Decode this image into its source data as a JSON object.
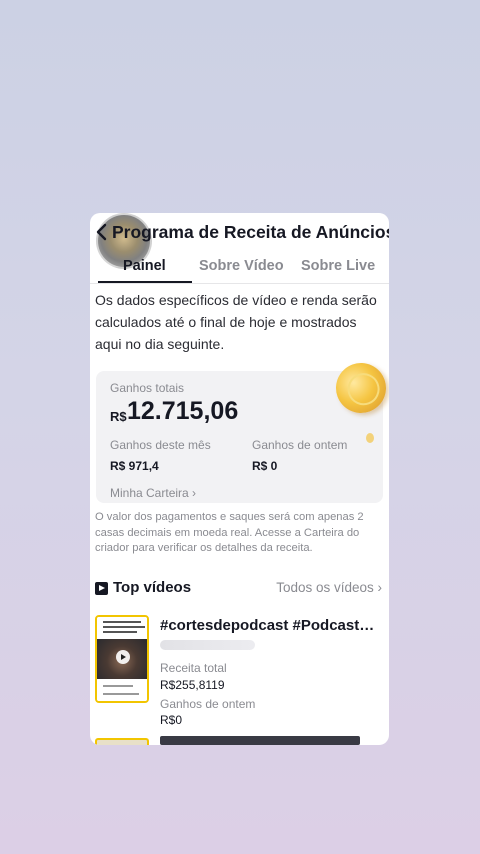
{
  "header": {
    "title": "Programa de Receita de Anúncios"
  },
  "tabs": [
    {
      "label": "Painel",
      "active": true
    },
    {
      "label": "Sobre Vídeo",
      "active": false
    },
    {
      "label": "Sobre Live",
      "active": false
    }
  ],
  "info_text": "Os dados específicos de vídeo e renda serão calculados até o final de hoje e mostrados aqui no dia seguinte.",
  "earnings": {
    "total_label": "Ganhos totais",
    "currency": "R$",
    "total_value": "12.715,06",
    "month_label": "Ganhos deste mês",
    "month_value": "R$ 971,4",
    "yesterday_label": "Ganhos de ontem",
    "yesterday_value": "R$ 0",
    "wallet_link": "Minha Carteira ›"
  },
  "note": "O valor dos pagamentos e saques será com apenas 2 casas decimais em moeda real. Acesse a Carteira do criador para verificar os detalhes da receita.",
  "top_videos": {
    "title": "Top vídeos",
    "all_link": "Todos os vídeos ›",
    "items": [
      {
        "title": "#cortesdepodcast #Podcast…",
        "revenue_label": "Receita total",
        "revenue_value": "R$255,8119",
        "yesterday_label": "Ganhos de ontem",
        "yesterday_value": "R$0"
      }
    ]
  },
  "colors": {
    "background_top": "#ccd1e4",
    "background_bottom": "#dccfe6",
    "text_primary": "#161823",
    "text_secondary": "#8a8b91",
    "thumbnail_border": "#f2c500",
    "coin": "#f5c542"
  }
}
